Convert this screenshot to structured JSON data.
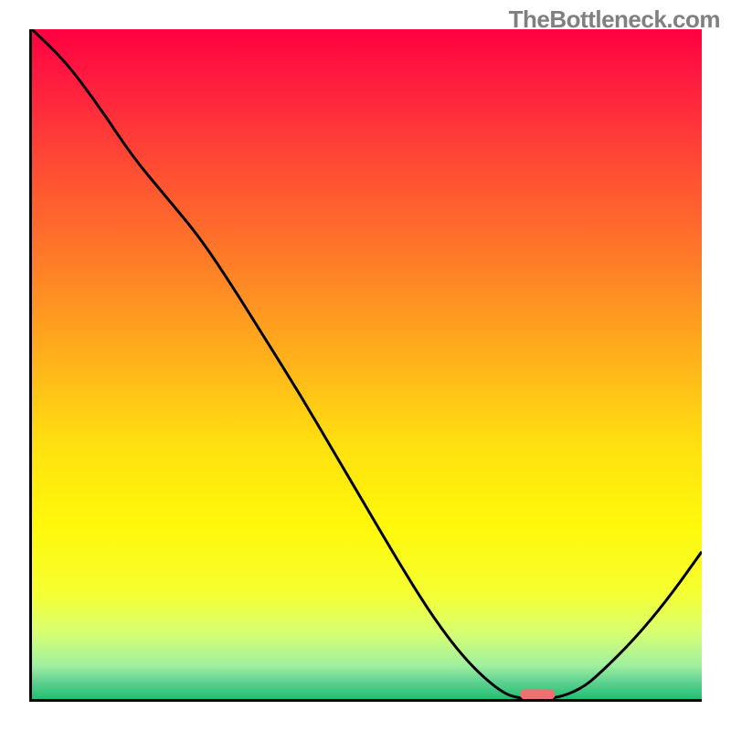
{
  "watermark": "TheBottleneck.com",
  "chart_data": {
    "type": "line",
    "title": "",
    "xlabel": "",
    "ylabel": "",
    "grid": false,
    "x": [
      0,
      5,
      10,
      15,
      20,
      25,
      30,
      35,
      40,
      45,
      50,
      55,
      60,
      65,
      70,
      73,
      78,
      82,
      85,
      90,
      95,
      100
    ],
    "values": [
      100,
      95.2,
      88.5,
      81,
      75,
      69,
      61.5,
      53.5,
      45.5,
      37,
      28.5,
      20,
      12,
      5.5,
      1.0,
      0,
      0,
      1.5,
      4,
      9,
      15,
      22
    ],
    "xlim": [
      0,
      100
    ],
    "ylim": [
      0,
      100
    ],
    "marker": {
      "x_center": 75.5,
      "x_half_width": 2.6,
      "y": 0.7
    },
    "background_gradient": {
      "type": "vertical",
      "stops": [
        {
          "offset": 0.0,
          "color": "#ff0040"
        },
        {
          "offset": 0.07,
          "color": "#ff1a40"
        },
        {
          "offset": 0.2,
          "color": "#ff4a34"
        },
        {
          "offset": 0.34,
          "color": "#ff7a28"
        },
        {
          "offset": 0.5,
          "color": "#ffb41a"
        },
        {
          "offset": 0.62,
          "color": "#ffe010"
        },
        {
          "offset": 0.74,
          "color": "#fff80a"
        },
        {
          "offset": 0.84,
          "color": "#f6ff30"
        },
        {
          "offset": 0.9,
          "color": "#d8ff70"
        },
        {
          "offset": 0.95,
          "color": "#a0f0a0"
        },
        {
          "offset": 0.975,
          "color": "#5ed090"
        },
        {
          "offset": 1.0,
          "color": "#20c070"
        }
      ]
    },
    "colors": {
      "curve": "#000000",
      "marker": "#ef7070",
      "axes": "#000000",
      "watermark": "#808080"
    }
  }
}
